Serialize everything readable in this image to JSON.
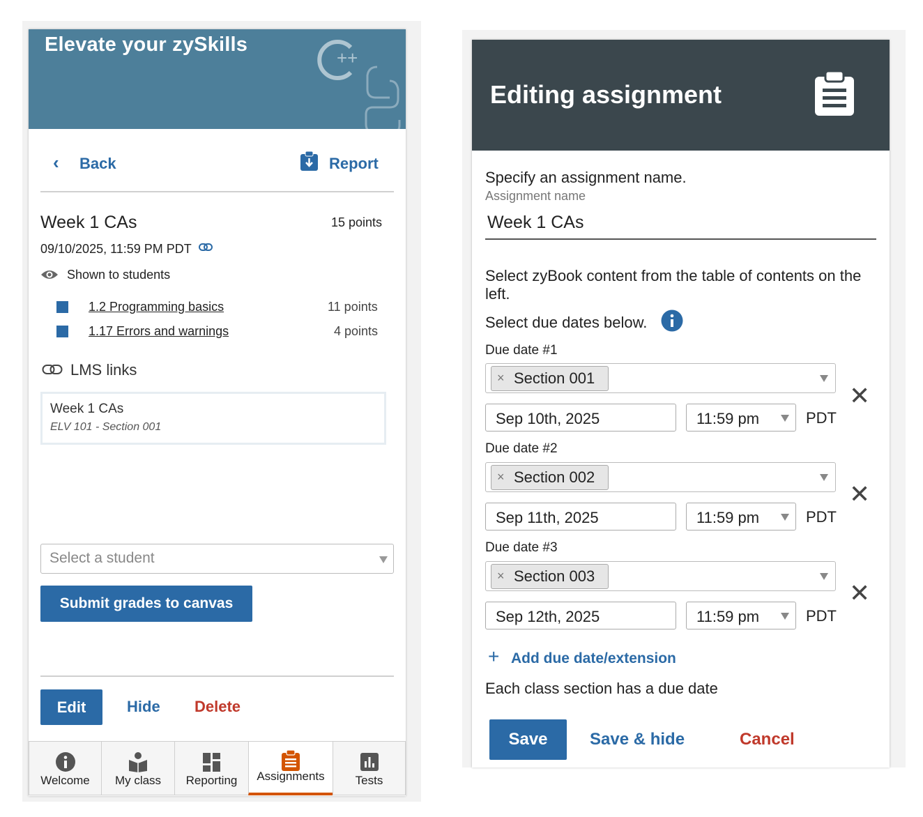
{
  "left": {
    "banner_title": "Elevate your zySkills",
    "nav": {
      "back_label": "Back",
      "report_label": "Report"
    },
    "assignment": {
      "title": "Week 1 CAs",
      "points": "15 points",
      "due": "09/10/2025, 11:59 PM PDT",
      "visibility": "Shown to students",
      "sections": [
        {
          "label": "1.2 Programming basics",
          "points": "11 points"
        },
        {
          "label": "1.17 Errors and warnings",
          "points": "4 points"
        }
      ]
    },
    "lms": {
      "heading": "LMS links",
      "link_title": "Week 1 CAs",
      "link_subtitle": "ELV 101 - Section 001"
    },
    "student_select_placeholder": "Select a student",
    "submit_label": "Submit grades to canvas",
    "actions": {
      "edit": "Edit",
      "hide": "Hide",
      "delete": "Delete"
    },
    "tabs": [
      {
        "label": "Welcome",
        "icon": "info-icon"
      },
      {
        "label": "My class",
        "icon": "class-icon"
      },
      {
        "label": "Reporting",
        "icon": "dashboard-icon"
      },
      {
        "label": "Assignments",
        "icon": "clipboard-icon",
        "active": true
      },
      {
        "label": "Tests",
        "icon": "chart-icon"
      }
    ]
  },
  "right": {
    "header_title": "Editing assignment",
    "name_prompt": "Specify an assignment name.",
    "name_label": "Assignment name",
    "name_value": "Week 1 CAs",
    "content_prompt": "Select zyBook content from the table of contents on the left.",
    "due_prompt": "Select due dates below.",
    "due_dates": [
      {
        "label": "Due date #1",
        "section": "Section 001",
        "date": "Sep 10th, 2025",
        "time": "11:59 pm",
        "tz": "PDT"
      },
      {
        "label": "Due date #2",
        "section": "Section 002",
        "date": "Sep 11th, 2025",
        "time": "11:59 pm",
        "tz": "PDT"
      },
      {
        "label": "Due date #3",
        "section": "Section 003",
        "date": "Sep 12th, 2025",
        "time": "11:59 pm",
        "tz": "PDT"
      }
    ],
    "add_label": "Add due date/extension",
    "note": "Each class section has a due date",
    "save": "Save",
    "save_hide": "Save & hide",
    "cancel": "Cancel"
  },
  "colors": {
    "accent": "#2b6aa6",
    "danger": "#c0392b",
    "active_tab": "#d35400",
    "banner": "#4d7f9a",
    "header": "#3b474d"
  }
}
